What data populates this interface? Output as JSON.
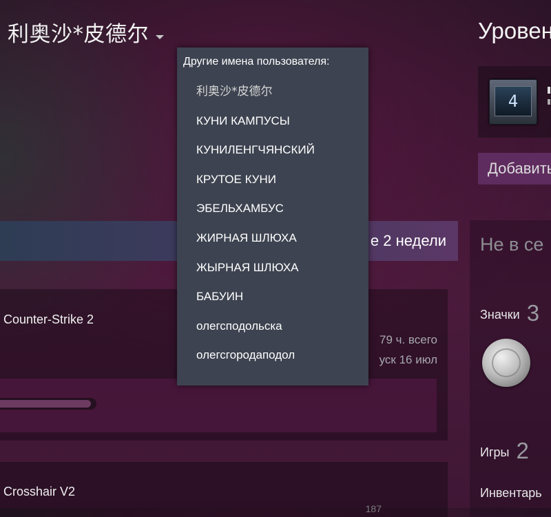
{
  "profile": {
    "persona_name": "利奥沙*皮德尔",
    "level_title": "Уровен",
    "level": "4",
    "add_friend_label": "Добавить"
  },
  "aliases_popup": {
    "title": "Другие имена пользователя:",
    "names": [
      "利奥沙*皮德尔",
      "КУНИ КАМПУСЫ",
      "КУНИЛЕНГЧЯНСКИЙ",
      "КРУТОЕ КУНИ",
      "ЭБЕЛЬХАМБУС",
      "ЖИРНАЯ ШЛЮХА",
      "ЖЫРНАЯ ШЛЮХА",
      "БАБУИН",
      "олегсподольска",
      "олегсгородаподол"
    ]
  },
  "recent_activity": {
    "header_text": "е 2 недели",
    "games": [
      {
        "title": "Counter-Strike 2",
        "hours_total": "79 ч. всего",
        "last_played": "уск 16 июл",
        "achievement_progress": 0.2,
        "icon": "counter-strike-icon"
      },
      {
        "title": "Crosshair V2",
        "hours_total": "187"
      }
    ]
  },
  "side_stats": {
    "status_text": "Не в се",
    "badges_label": "Значки",
    "badges_count": "3",
    "games_label": "Игры",
    "games_count": "2",
    "inventory_label": "Инвентарь"
  },
  "colors": {
    "popup_bg": "#3d4350",
    "accent_button": "#5f2c5f"
  }
}
